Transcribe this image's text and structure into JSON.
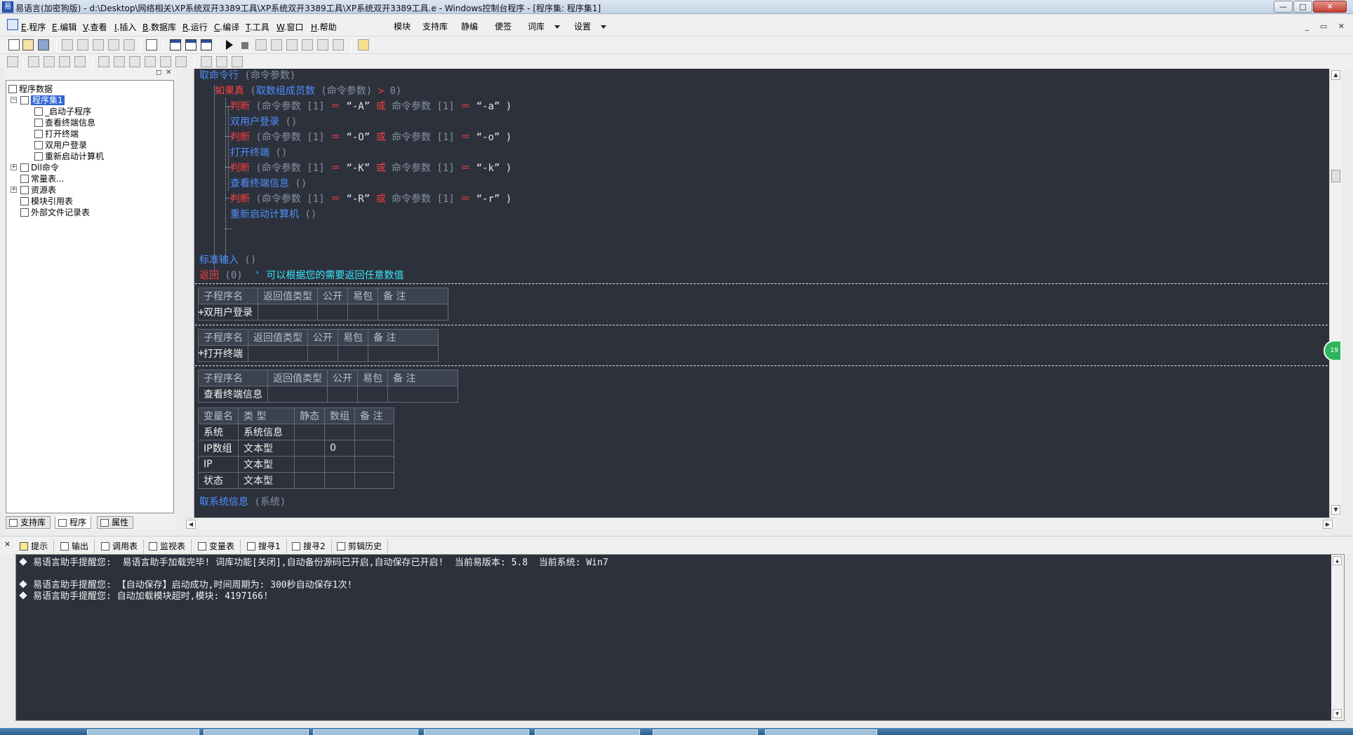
{
  "window": {
    "title": "易语言(加密狗版) - d:\\Desktop\\网络相关\\XP系统双开3389工具\\XP系统双开3389工具\\XP系统双开3389工具.e - Windows控制台程序 - [程序集: 程序集1]",
    "minimize": "—",
    "maximize": "□",
    "close": "✕"
  },
  "menubar": {
    "items": [
      {
        "key": "E",
        "label": ".程序"
      },
      {
        "key": "E",
        "label": ".编辑"
      },
      {
        "key": "V",
        "label": ".查看"
      },
      {
        "key": "I",
        "label": ".插入"
      },
      {
        "key": "B",
        "label": ".数据库"
      },
      {
        "key": "R",
        "label": ".运行"
      },
      {
        "key": "C",
        "label": ".编译"
      },
      {
        "key": "T",
        "label": ".工具"
      },
      {
        "key": "W",
        "label": ".窗口"
      },
      {
        "key": "H",
        "label": ".帮助"
      }
    ],
    "extras": [
      "模块",
      "支持库",
      "静编",
      "便签",
      "词库",
      "设置"
    ],
    "mdi_buttons": "_ ▭ ✕"
  },
  "left_panel": {
    "header_buttons": [
      "◻",
      "✕"
    ],
    "tree": {
      "root": "程序数据",
      "assembly": "程序集1",
      "subs": [
        "_启动子程序",
        "查看终端信息",
        "打开终端",
        "双用户登录",
        "重新启动计算机"
      ],
      "others": [
        "Dll命令",
        "常量表...",
        "资源表",
        "模块引用表",
        "外部文件记录表"
      ]
    },
    "tabs": [
      "支持库",
      "程序",
      "属性"
    ]
  },
  "code": {
    "line1": {
      "fn": "取命令行",
      "args": " (命令参数)"
    },
    "line2": {
      "kw": "如果真",
      "rest_a": " (",
      "fn": "取数组成员数",
      "rest_b": " (命令参数) ",
      "op": ">",
      "rest_c": " 0)"
    },
    "checks": [
      {
        "kw": "判断",
        "p1": " (命令参数 [1] ",
        "eq": "＝",
        "s1": " “-A” ",
        "or": "或",
        "p2": " 命令参数 [1] ",
        "s2": " “-a” )",
        "call": "双用户登录",
        "call_args": " ()"
      },
      {
        "kw": "判断",
        "p1": " (命令参数 [1] ",
        "eq": "＝",
        "s1": " “-O” ",
        "or": "或",
        "p2": " 命令参数 [1] ",
        "s2": " “-o” )",
        "call": "打开终端",
        "call_args": " ()"
      },
      {
        "kw": "判断",
        "p1": " (命令参数 [1] ",
        "eq": "＝",
        "s1": " “-K” ",
        "or": "或",
        "p2": " 命令参数 [1] ",
        "s2": " “-k” )",
        "call": "查看终端信息",
        "call_args": " ()"
      },
      {
        "kw": "判断",
        "p1": " (命令参数 [1] ",
        "eq": "＝",
        "s1": " “-R” ",
        "or": "或",
        "p2": " 命令参数 [1] ",
        "s2": " “-r” )",
        "call": "重新启动计算机",
        "call_args": " ()"
      }
    ],
    "stdin_line": {
      "fn": "标准输入",
      "args": " ()"
    },
    "return_line": {
      "kw": "返回",
      "args": " (0)  ",
      "comment": "' 可以根据您的需要返回任意数值"
    },
    "sub_headers": [
      "子程序名",
      "返回值类型",
      "公开",
      "易包",
      "备 注"
    ],
    "subs": [
      "双用户登录",
      "打开终端",
      "查看终端信息"
    ],
    "var_headers": [
      "变量名",
      "类 型",
      "静态",
      "数组",
      "备 注"
    ],
    "vars": [
      {
        "name": "系统",
        "type": "系统信息",
        "array": ""
      },
      {
        "name": "IP数组",
        "type": "文本型",
        "array": "0"
      },
      {
        "name": "IP",
        "type": "文本型",
        "array": ""
      },
      {
        "name": "状态",
        "type": "文本型",
        "array": ""
      }
    ],
    "sysinfo_line": {
      "fn": "取系统信息",
      "args": " (系统)"
    },
    "plus": "+"
  },
  "badge": "19",
  "output_tabs": [
    "提示",
    "输出",
    "调用表",
    "监视表",
    "变量表",
    "搜寻1",
    "搜寻2",
    "剪辑历史"
  ],
  "output_lines": [
    "易语言助手提醒您:  易语言助手加载完毕! 词库功能[关闭],自动备份源码已开启,自动保存已开启!  当前易版本: 5.8  当前系统: Win7",
    "易语言助手提醒您: 【自动保存】启动成功,时间周期为: 300秒自动保存1次!",
    "易语言助手提醒您: 自动加载模块超时,模块: 4197166!"
  ],
  "colors": {
    "editor_bg": "#2c313c",
    "command": "#4f8fff",
    "keyword": "#ff3d3d",
    "comment": "#39e6ff"
  }
}
